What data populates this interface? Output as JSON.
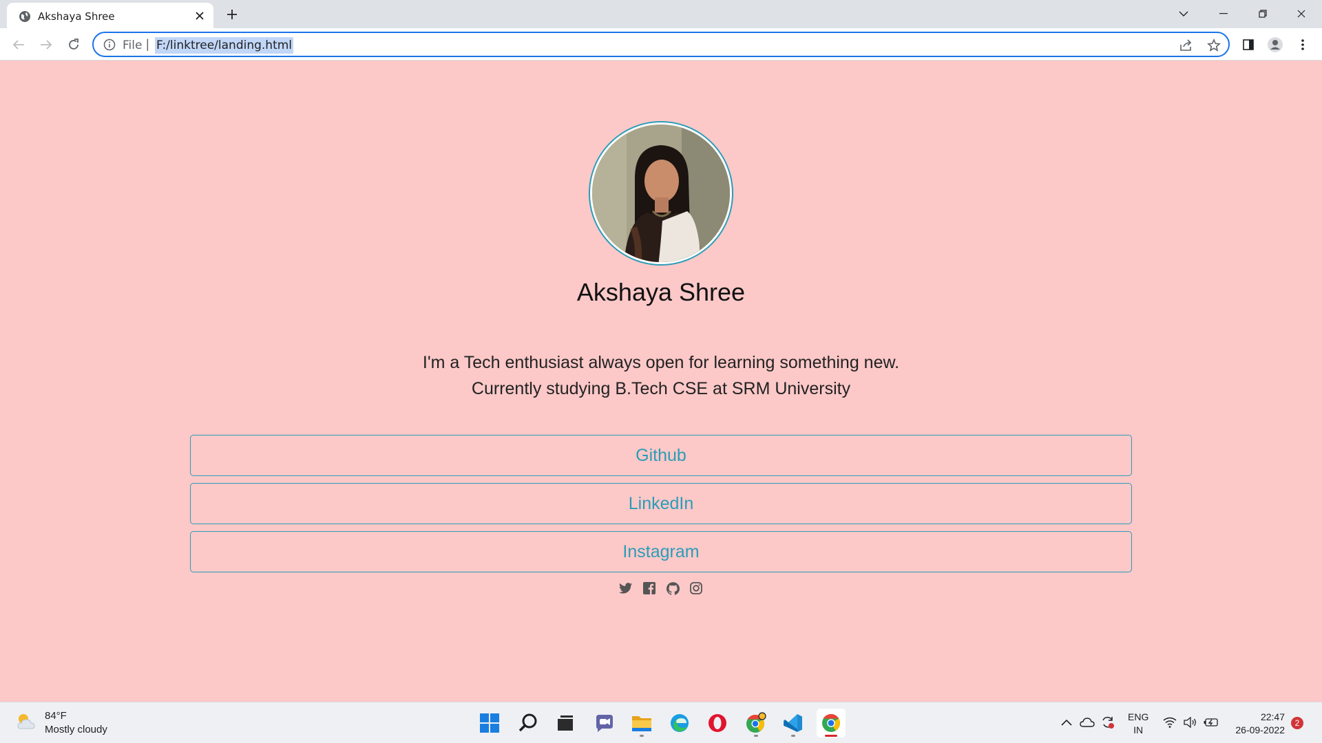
{
  "browser": {
    "tab_title": "Akshaya Shree",
    "address_scheme": "File",
    "address_url": "F:/linktree/landing.html"
  },
  "profile": {
    "name": "Akshaya Shree",
    "bio_line1": "I'm a Tech enthusiast always open for learning something new.",
    "bio_line2": "Currently studying B.Tech CSE at SRM University",
    "links": [
      "Github",
      "LinkedIn",
      "Instagram"
    ],
    "social_icons": [
      "twitter-icon",
      "facebook-icon",
      "github-icon",
      "instagram-icon"
    ],
    "accent_color": "#2a9db8",
    "background_color": "#fcc8c8"
  },
  "taskbar": {
    "weather_temp": "84°F",
    "weather_condition": "Mostly cloudy",
    "lang_line1": "ENG",
    "lang_line2": "IN",
    "time": "22:47",
    "date": "26-09-2022",
    "notification_count": "2"
  }
}
